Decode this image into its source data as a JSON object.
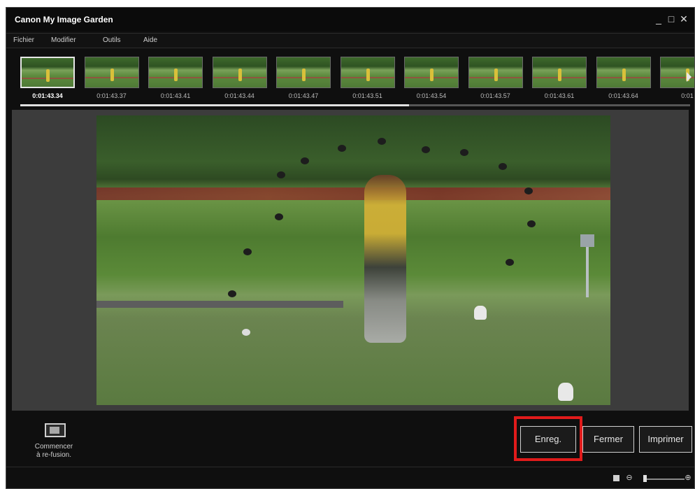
{
  "window": {
    "title": "Canon My Image Garden",
    "controls": {
      "minimize": "_",
      "maximize": "□",
      "close": "✕"
    }
  },
  "menu": [
    "Fichier",
    "Modifier",
    "Outils",
    "Aide"
  ],
  "thumbnails": [
    {
      "time": "0:01:43.34",
      "selected": true
    },
    {
      "time": "0:01:43.37",
      "selected": false
    },
    {
      "time": "0:01:43.41",
      "selected": false
    },
    {
      "time": "0:01:43.44",
      "selected": false
    },
    {
      "time": "0:01:43.47",
      "selected": false
    },
    {
      "time": "0:01:43.51",
      "selected": false
    },
    {
      "time": "0:01:43.54",
      "selected": false
    },
    {
      "time": "0:01:43.57",
      "selected": false
    },
    {
      "time": "0:01:43.61",
      "selected": false
    },
    {
      "time": "0:01:43.64",
      "selected": false
    },
    {
      "time": "0:01",
      "selected": false
    }
  ],
  "strip_scroll_fraction": 0.58,
  "actions": {
    "refusion_label_line1": "Commencer",
    "refusion_label_line2": "à re-fusion.",
    "save": "Enreg.",
    "close": "Fermer",
    "print": "Imprimer"
  },
  "status": {
    "fit_icon": "fit-to-window-icon",
    "zoom_out": "⊖",
    "zoom_in": "⊕",
    "zoom_fraction": 0.05
  },
  "colors": {
    "highlight": "#e11b1b",
    "background": "#0f0f0f",
    "stage": "#3c3c3c"
  }
}
